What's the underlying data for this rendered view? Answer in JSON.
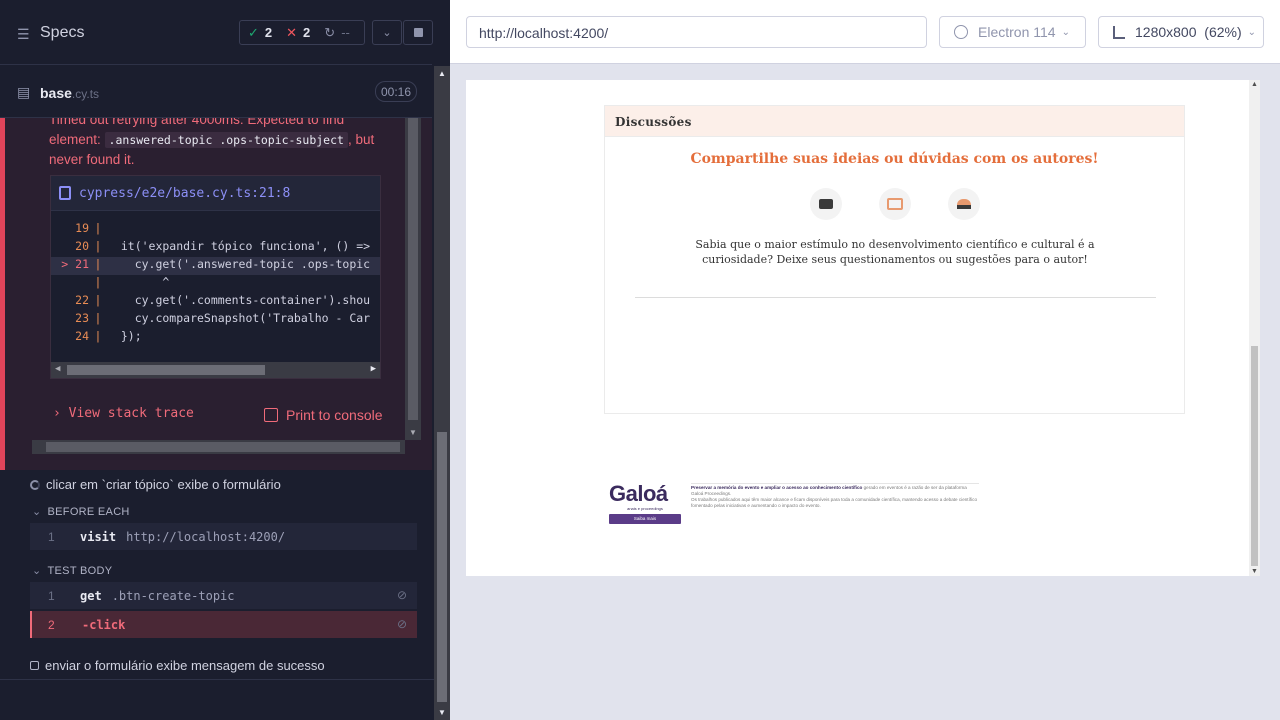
{
  "reporter": {
    "header_title": "Specs",
    "stats": {
      "passed": "2",
      "failed": "2",
      "pending": "--"
    },
    "file": {
      "name": "base",
      "ext": ".cy.ts",
      "timer": "00:16"
    },
    "error": {
      "msg_part1": "Timed out retrying after 4000ms: Expected to find element:",
      "selector": ".answered-topic .ops-topic-subject",
      "msg_part2": ", but never found it.",
      "code_file": "cypress/e2e/base.cy.ts:21:8",
      "code_lines": [
        {
          "ln": "19",
          "code": ""
        },
        {
          "ln": "20",
          "code": "  it('expandir tópico funciona', () =>"
        },
        {
          "ln": "> 21",
          "code": "    cy.get('.answered-topic .ops-topic",
          "active": true
        },
        {
          "ln": "",
          "code": "        ^"
        },
        {
          "ln": "22",
          "code": "    cy.get('.comments-container').shou"
        },
        {
          "ln": "23",
          "code": "    cy.compareSnapshot('Trabalho - Car"
        },
        {
          "ln": "24",
          "code": "  });"
        }
      ],
      "view_stack": "View stack trace",
      "print_console": "Print to console"
    },
    "test_running": "clicar em `criar tópico` exibe o formulário",
    "before_each_label": "BEFORE EACH",
    "before_each_cmds": [
      {
        "num": "1",
        "name": "visit",
        "arg": "http://localhost:4200/"
      }
    ],
    "test_body_label": "TEST BODY",
    "test_body_cmds": [
      {
        "num": "1",
        "name": "get",
        "arg": ".btn-create-topic"
      },
      {
        "num": "2",
        "name": "-click",
        "arg": ""
      }
    ],
    "test_pending": "enviar o formulário exibe mensagem de sucesso"
  },
  "aut": {
    "url": "http://localhost:4200/",
    "browser": "Electron 114",
    "viewport": "1280x800",
    "zoom": "(62%)"
  },
  "page": {
    "discussion_title": "Discussões",
    "cta": "Compartilhe suas ideias ou dúvidas com os autores!",
    "description": "Sabia que o maior estímulo no desenvolvimento científico e cultural é a curiosidade? Deixe seus questionamentos ou sugestões para o autor!",
    "logo_word": "Galoá",
    "logo_sub": "anais e proceedings",
    "logo_button": "Saiba mais",
    "footer_bold": "Preservar a memória do evento e ampliar o acesso ao conhecimento científico",
    "footer_rest": "gerado em eventos é a razão de ser da plataforma Galoá Proceedings.",
    "footer_line2": "Os trabalhos publicados aqui têm maior alcance e ficam disponíveis para toda a comunidade científica, mantendo acesso a debate científico fomentado pelas iniciativas e aumentando o impacto do evento."
  }
}
